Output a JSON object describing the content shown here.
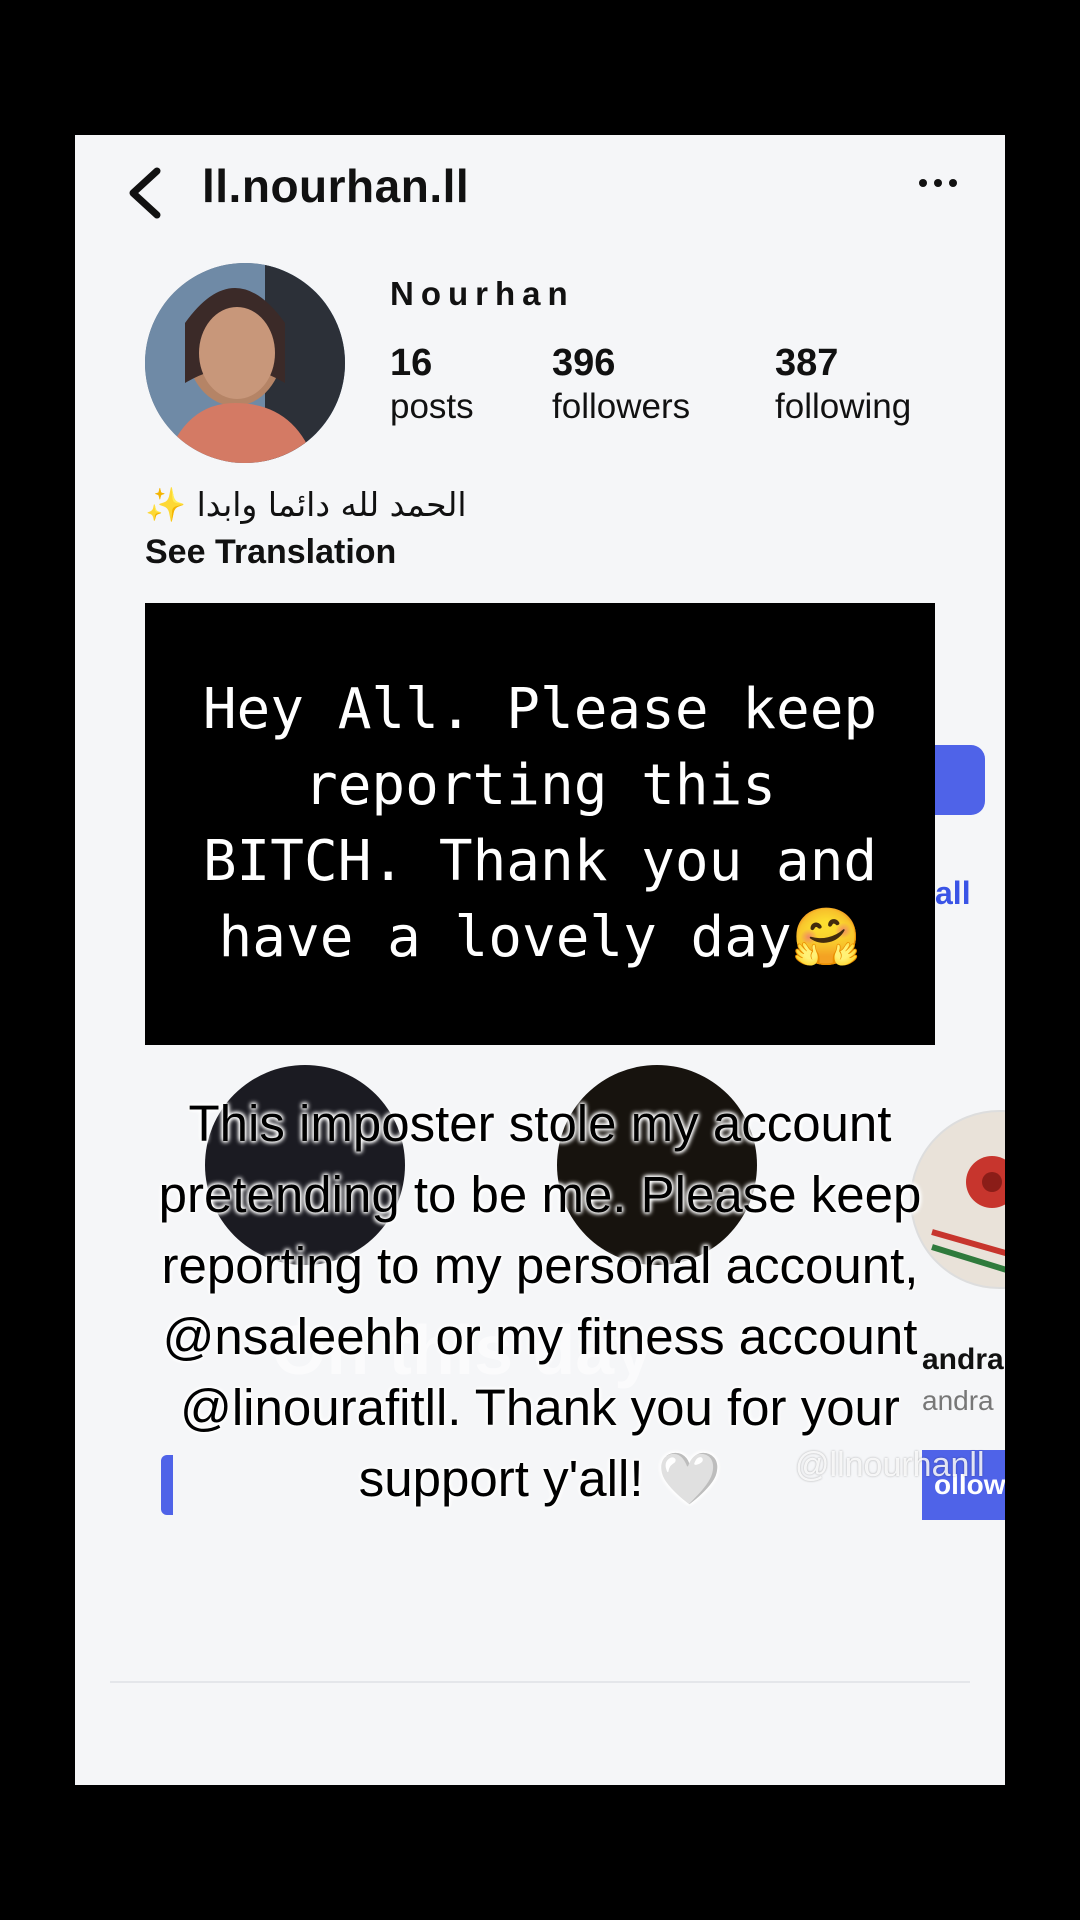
{
  "profile": {
    "username": "ll.nourhan.ll",
    "display_name": "Nourhan",
    "stats": [
      {
        "value": "16",
        "label": "posts"
      },
      {
        "value": "396",
        "label": "followers"
      },
      {
        "value": "387",
        "label": "following"
      }
    ],
    "bio": "الحمد لله دائما وابدا ✨",
    "see_translation": "See Translation"
  },
  "background_partial": {
    "see_all": "all",
    "suggested_name": "andra",
    "suggested_handle": "andra",
    "follow_label": "ollow"
  },
  "caption_box": {
    "text": "Hey All. Please keep reporting this BITCH. Thank you and have a lovely day🤗"
  },
  "overlay": {
    "text": "This imposter stole my account pretending to be me. Please keep reporting to my personal account, @nsaleehh or my fitness account @linourafitll. Thank you for your support y'all! 🤍"
  },
  "watermark": {
    "ghost": "On this day",
    "handle": "@llnourhanll"
  },
  "colors": {
    "background": "#000000",
    "screen": "#f5f6f8",
    "accent_blue": "#4f63e8"
  }
}
